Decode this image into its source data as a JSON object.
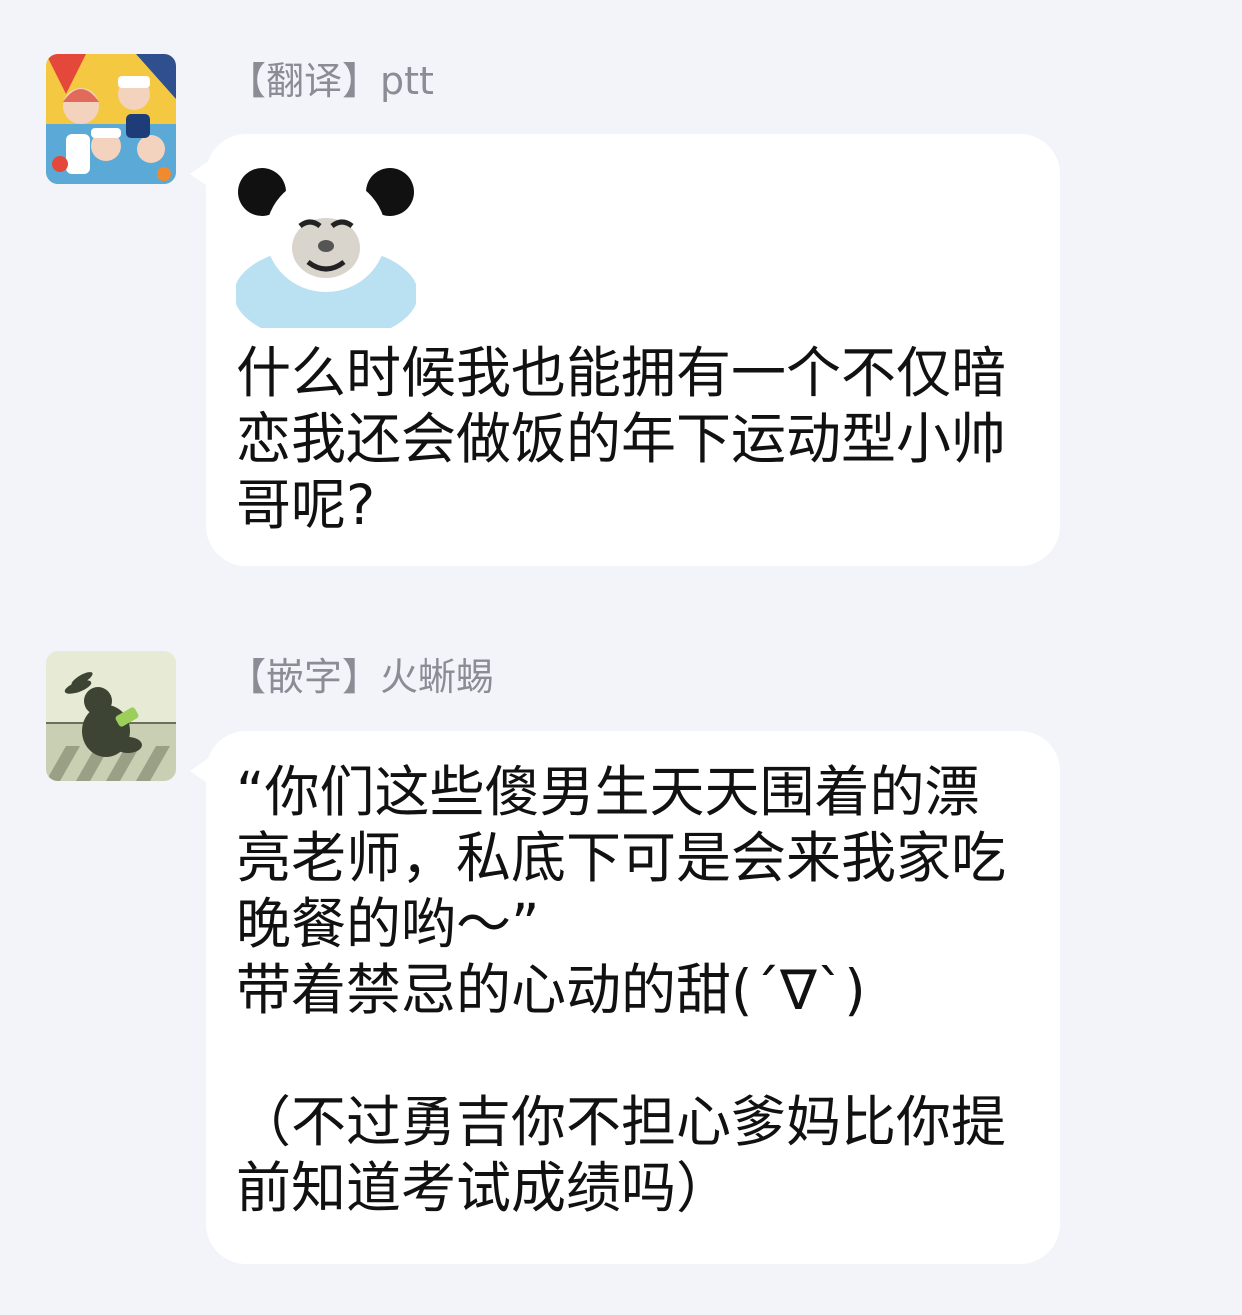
{
  "messages": [
    {
      "avatar_icon": "anime-group-avatar-icon",
      "sender": "【翻译】ptt",
      "sticker_icon": "panda-face-sticker-icon",
      "text": "什么时候我也能拥有一个不仅暗恋我还会做饭的年下运动型小帅哥呢?"
    },
    {
      "avatar_icon": "rabbit-avatar-icon",
      "sender": "【嵌字】火蜥蜴",
      "text": "“你们这些傻男生天天围着的漂亮老师，私底下可是会来我家吃晚餐的哟～”\n带着禁忌的心动的甜(´∇`)\n\n（不过勇吉你不担心爹妈比你提前知道考试成绩吗）"
    }
  ],
  "colors": {
    "background": "#f3f4f9",
    "bubble": "#ffffff",
    "sender_name": "#8a8d96",
    "message_text": "#111111"
  }
}
